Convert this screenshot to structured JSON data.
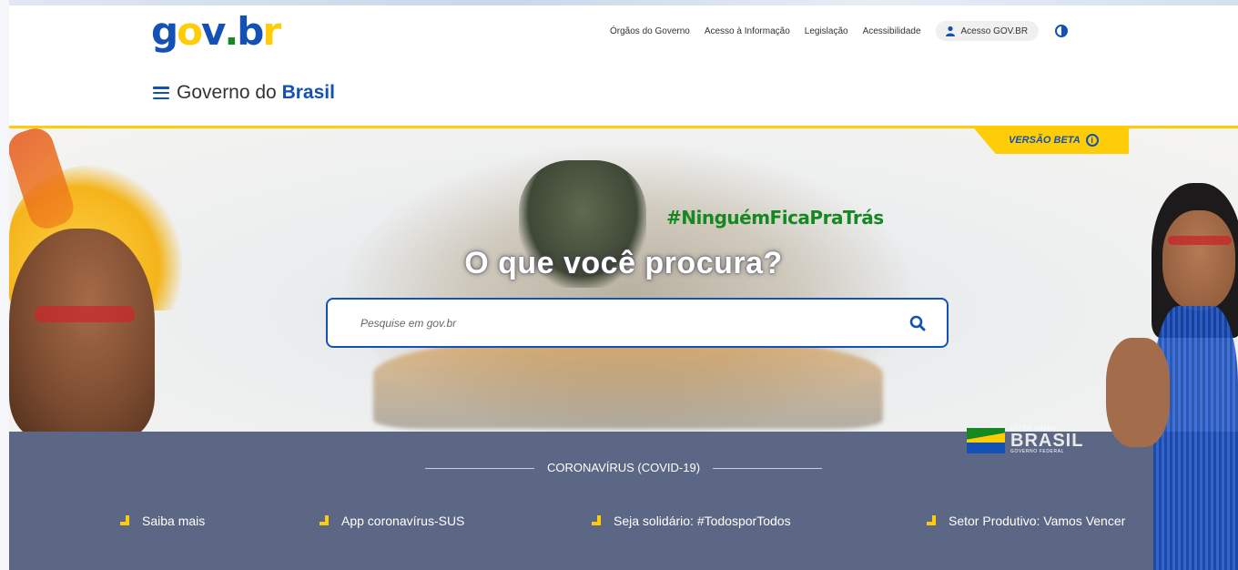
{
  "header": {
    "logo": {
      "g": "g",
      "o": "o",
      "v": "v",
      "dot": ".",
      "b": "b",
      "r": "r"
    },
    "links": [
      "Órgãos do Governo",
      "Acesso à Informação",
      "Legislação",
      "Acessibilidade"
    ],
    "login_label": "Acesso GOV.BR",
    "title_prefix": "Governo do ",
    "title_bold": "Brasil"
  },
  "hero": {
    "beta_label": "VERSÃO BETA",
    "info_glyph": "i",
    "hashtag": "#NinguémFicaPraTrás",
    "question": "O que você procura?",
    "search_placeholder": "Pesquise em gov.br"
  },
  "covid": {
    "title": "CORONAVÍRUS (COVID-19)",
    "brand_small": "PÁTRIA AMADA",
    "brand_main": "BRASIL",
    "brand_sub": "GOVERNO FEDERAL",
    "links": [
      "Saiba mais",
      "App coronavírus-SUS",
      "Seja solidário: #TodosporTodos",
      "Setor Produtivo: Vamos Vencer"
    ]
  },
  "colors": {
    "primary": "#1351b4",
    "accent": "#ffcd07",
    "green": "#168821",
    "covid_bar": "#5b6784"
  }
}
